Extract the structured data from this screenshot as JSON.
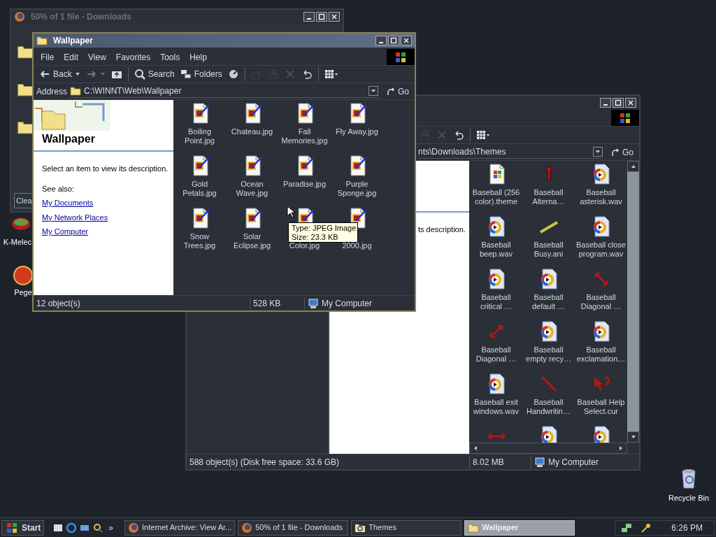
{
  "desktop_icons": [
    {
      "label": "K-Melec",
      "kind": "browser"
    },
    {
      "label": "Pege",
      "kind": "ball"
    },
    {
      "label": "Recycle Bin",
      "kind": "recycle"
    }
  ],
  "downloads_window": {
    "title": "50% of 1 file - Downloads",
    "active": false,
    "button": "Clea"
  },
  "themes_window": {
    "active": false,
    "toolbar": [
      {
        "kind": "copy",
        "disabled": true
      },
      {
        "kind": "delete",
        "disabled": true
      },
      {
        "kind": "undo",
        "disabled": false
      },
      {
        "kind": "views",
        "disabled": false
      }
    ],
    "address_path": "nts\\Downloads\\Themes",
    "go": "Go",
    "description": "ts description.",
    "files": [
      {
        "lines": [
          "Baseball (256",
          "color).theme"
        ],
        "kind": "theme"
      },
      {
        "lines": [
          "Baseball",
          "Alterna…"
        ],
        "kind": "up-arrow"
      },
      {
        "lines": [
          "Baseball",
          "asterisk.wav"
        ],
        "kind": "sound"
      },
      {
        "lines": [
          "Baseball",
          "beep.wav"
        ],
        "kind": "sound"
      },
      {
        "lines": [
          "Baseball",
          "Busy.ani"
        ],
        "kind": "busy"
      },
      {
        "lines": [
          "Baseball close",
          "program.wav"
        ],
        "kind": "sound"
      },
      {
        "lines": [
          "Baseball",
          "critical …"
        ],
        "kind": "sound"
      },
      {
        "lines": [
          "Baseball",
          "default …"
        ],
        "kind": "sound"
      },
      {
        "lines": [
          "Baseball",
          "Diagonal …"
        ],
        "kind": "diagonal"
      },
      {
        "lines": [
          "Baseball",
          "Diagonal …"
        ],
        "kind": "diagonal2"
      },
      {
        "lines": [
          "Baseball",
          "empty recy…"
        ],
        "kind": "sound"
      },
      {
        "lines": [
          "Baseball",
          "exclamation…"
        ],
        "kind": "sound"
      },
      {
        "lines": [
          "Baseball exit",
          "windows.wav"
        ],
        "kind": "sound"
      },
      {
        "lines": [
          "Baseball",
          "Handwritin…"
        ],
        "kind": "pen"
      },
      {
        "lines": [
          "Baseball Help",
          "Select.cur"
        ],
        "kind": "help"
      },
      {
        "kind": "horizontal"
      },
      {
        "kind": "sound"
      },
      {
        "kind": "sound"
      }
    ],
    "status": [
      "588 object(s) (Disk free space: 33.6 GB)",
      "8.02 MB",
      "My Computer"
    ]
  },
  "wallpaper_window": {
    "title": "Wallpaper",
    "active": true,
    "menu": [
      "File",
      "Edit",
      "View",
      "Favorites",
      "Tools",
      "Help"
    ],
    "toolbar": [
      {
        "kind": "back",
        "label": "Back",
        "disabled": false
      },
      {
        "kind": "forward",
        "disabled": true
      },
      {
        "kind": "up",
        "disabled": false
      },
      {
        "kind": "search",
        "label": "Search",
        "disabled": false
      },
      {
        "kind": "folders",
        "label": "Folders",
        "disabled": false
      },
      {
        "kind": "history",
        "disabled": false
      },
      {
        "kind": "move",
        "disabled": true
      },
      {
        "kind": "copy",
        "disabled": true
      },
      {
        "kind": "delete",
        "disabled": true
      },
      {
        "kind": "undo",
        "disabled": false
      },
      {
        "kind": "views",
        "disabled": false
      }
    ],
    "address_label": "Address",
    "address_path": "C:\\WINNT\\Web\\Wallpaper",
    "go": "Go",
    "heading": "Wallpaper",
    "description": "Select an item to view its description.",
    "see_also": "See also:",
    "links": [
      "My Documents",
      "My Network Places",
      "My Computer"
    ],
    "files": [
      {
        "lines": [
          "Boiling",
          "Point.jpg"
        ],
        "kind": "jpeg"
      },
      {
        "lines": [
          "Chateau.jpg"
        ],
        "kind": "jpeg"
      },
      {
        "lines": [
          "Fall",
          "Memories.jpg"
        ],
        "kind": "jpeg"
      },
      {
        "lines": [
          "Fly Away.jpg"
        ],
        "kind": "jpeg"
      },
      {
        "lines": [
          "Gold",
          "Petals.jpg"
        ],
        "kind": "jpeg"
      },
      {
        "lines": [
          "Ocean",
          "Wave.jpg"
        ],
        "kind": "jpeg"
      },
      {
        "lines": [
          "Paradise.jpg"
        ],
        "kind": "jpeg"
      },
      {
        "lines": [
          "Purple",
          "Sponge.jpg"
        ],
        "kind": "jpeg"
      },
      {
        "lines": [
          "Snow",
          "Trees.jpg"
        ],
        "kind": "jpeg"
      },
      {
        "lines": [
          "Solar",
          "Eclipse.jpg"
        ],
        "kind": "jpeg"
      },
      {
        "lines": [
          "Color.jpg"
        ],
        "kind": "jpeg"
      },
      {
        "lines": [
          "2000.jpg"
        ],
        "kind": "jpeg"
      }
    ],
    "status": [
      "12 object(s)",
      "528 KB",
      "My Computer"
    ]
  },
  "tooltip": [
    "Type: JPEG Image",
    "Size: 23.3 KB"
  ],
  "taskbar": {
    "start": "Start",
    "chevron": "»",
    "tasks": [
      {
        "label": "Internet Archive: View Ar...",
        "kind": "firefox",
        "selected": false
      },
      {
        "label": "50% of 1 file - Downloads",
        "kind": "firefox",
        "selected": false
      },
      {
        "label": "Themes",
        "kind": "explorer",
        "selected": false
      },
      {
        "label": "Wallpaper",
        "kind": "folder",
        "selected": true
      }
    ],
    "clock": "6:26 PM"
  }
}
